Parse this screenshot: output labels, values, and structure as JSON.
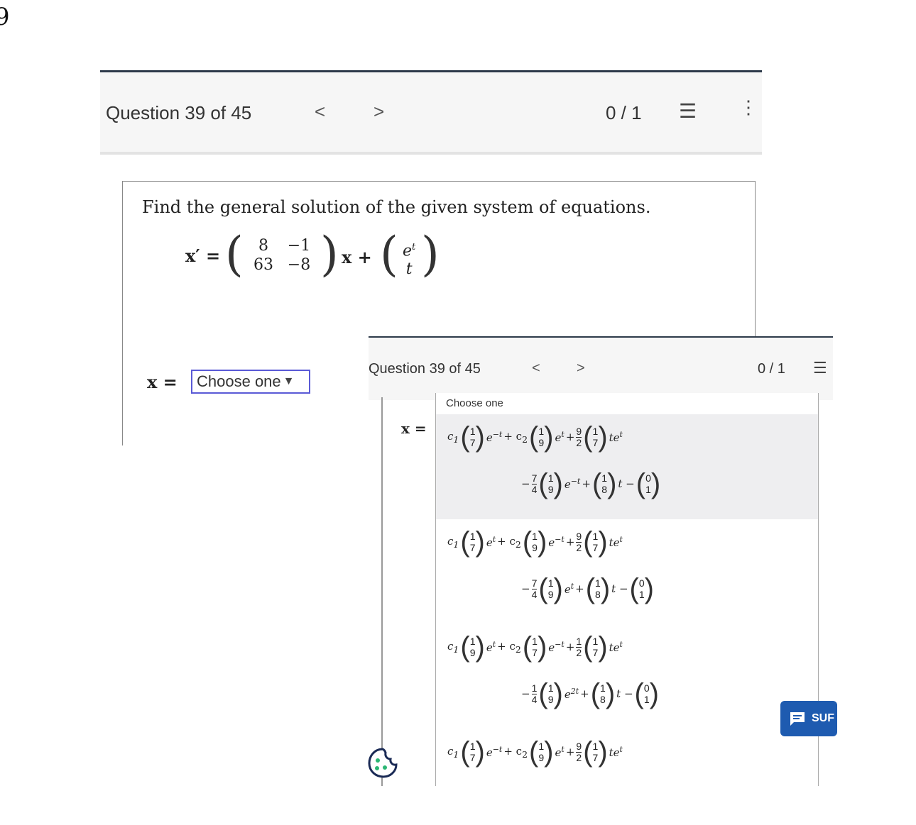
{
  "corner_glyph": "9",
  "back_window": {
    "question_label": "Question 39 of 45",
    "prev_arrow": "<",
    "next_arrow": ">",
    "score": "0 / 1",
    "list_icon": "list-icon",
    "menu_icon": "kebab-menu-icon",
    "prompt": "Find the general solution of the given system of equations.",
    "equation": {
      "lhs": "x′ =",
      "matrix": [
        [
          "8",
          "−1"
        ],
        [
          "63",
          "−8"
        ]
      ],
      "mid": "x +",
      "vector": [
        "e",
        "t"
      ],
      "vector_sup": "t"
    },
    "answer_label": "x =",
    "select_value": "Choose one",
    "select_arrow": "▼"
  },
  "front_window": {
    "question_label": "Question 39 of 45",
    "prev_arrow": "<",
    "next_arrow": ">",
    "score": "0 / 1",
    "list_icon": "list-icon",
    "dropdown_header": "Choose one",
    "answer_label": "x =",
    "options": [
      {
        "line1": {
          "t1_vec": [
            "1",
            "7"
          ],
          "t1_exp": "−t",
          "t2_vec": [
            "1",
            "9"
          ],
          "t2_exp": "t",
          "frac": [
            "9",
            "2"
          ],
          "t3_vec": [
            "1",
            "7"
          ]
        },
        "line2": {
          "frac": [
            "7",
            "4"
          ],
          "v1": [
            "1",
            "9"
          ],
          "v1_exp": "−t",
          "v2": [
            "1",
            "8"
          ],
          "v3": [
            "0",
            "1"
          ]
        }
      },
      {
        "line1": {
          "t1_vec": [
            "1",
            "7"
          ],
          "t1_exp": "t",
          "t2_vec": [
            "1",
            "9"
          ],
          "t2_exp": "−t",
          "frac": [
            "9",
            "2"
          ],
          "t3_vec": [
            "1",
            "7"
          ]
        },
        "line2": {
          "frac": [
            "7",
            "4"
          ],
          "v1": [
            "1",
            "9"
          ],
          "v1_exp": "t",
          "v2": [
            "1",
            "8"
          ],
          "v3": [
            "0",
            "1"
          ]
        }
      },
      {
        "line1": {
          "t1_vec": [
            "1",
            "9"
          ],
          "t1_exp": "t",
          "t2_vec": [
            "1",
            "7"
          ],
          "t2_exp": "−t",
          "frac": [
            "1",
            "2"
          ],
          "t3_vec": [
            "1",
            "7"
          ]
        },
        "line2": {
          "frac": [
            "1",
            "4"
          ],
          "v1": [
            "1",
            "9"
          ],
          "v1_exp": "2t",
          "v2": [
            "1",
            "8"
          ],
          "v3": [
            "0",
            "1"
          ]
        }
      },
      {
        "line1": {
          "t1_vec": [
            "1",
            "7"
          ],
          "t1_exp": "−t",
          "t2_vec": [
            "1",
            "9"
          ],
          "t2_exp": "t",
          "frac": [
            "9",
            "2"
          ],
          "t3_vec": [
            "1",
            "7"
          ]
        }
      }
    ],
    "support_label": "SUF",
    "support_icon": "chat-icon",
    "cookie_icon": "cookie-icon"
  },
  "colors": {
    "header_bg": "#f6f6f6",
    "select_border": "#5a5ad6",
    "support_bg": "#1e5bb0",
    "highlight_option": "#eeeef0"
  }
}
